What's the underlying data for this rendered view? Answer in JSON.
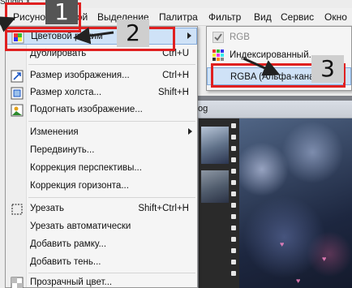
{
  "app": {
    "title_fragment": "Studio X"
  },
  "menubar": {
    "items": [
      "Рисунок",
      "Слой",
      "Выделение",
      "Палитра",
      "Фильтр",
      "Вид",
      "Сервис",
      "Окно"
    ]
  },
  "menu": {
    "items": [
      {
        "label": "Цветовой режим",
        "shortcut": "",
        "icon": "color-mode-icon"
      },
      {
        "label": "Дублировать",
        "shortcut": "Ctrl+U",
        "icon": ""
      },
      {
        "label": "Размер изображения...",
        "shortcut": "Ctrl+H",
        "icon": "resize-image-icon"
      },
      {
        "label": "Размер холста...",
        "shortcut": "Shift+H",
        "icon": "canvas-size-icon"
      },
      {
        "label": "Подогнать изображение...",
        "shortcut": "",
        "icon": "fit-image-icon"
      },
      {
        "label": "Изменения",
        "shortcut": "",
        "icon": ""
      },
      {
        "label": "Передвинуть...",
        "shortcut": "",
        "icon": ""
      },
      {
        "label": "Коррекция перспективы...",
        "shortcut": "",
        "icon": ""
      },
      {
        "label": "Коррекция горизонта...",
        "shortcut": "",
        "icon": ""
      },
      {
        "label": "Урезать",
        "shortcut": "Shift+Ctrl+H",
        "icon": "crop-icon"
      },
      {
        "label": "Урезать автоматически",
        "shortcut": "",
        "icon": ""
      },
      {
        "label": "Добавить рамку...",
        "shortcut": "",
        "icon": ""
      },
      {
        "label": "Добавить тень...",
        "shortcut": "",
        "icon": ""
      },
      {
        "label": "Прозрачный цвет...",
        "shortcut": "",
        "icon": "transparent-color-icon"
      }
    ]
  },
  "submenu": {
    "items": [
      {
        "label": "RGB",
        "icon": "checkmark-icon"
      },
      {
        "label": "Индексированный...",
        "icon": "palette-grid-icon"
      },
      {
        "label": "RGBA (Альфа-канал)",
        "icon": ""
      }
    ]
  },
  "document": {
    "title_fragment": "og"
  },
  "annotations": {
    "step1": "1",
    "step2": "2",
    "step3": "3"
  },
  "colors": {
    "annotation_red": "#e02020",
    "highlight": "#cfe2f7",
    "highlight_border": "#84acdd"
  }
}
